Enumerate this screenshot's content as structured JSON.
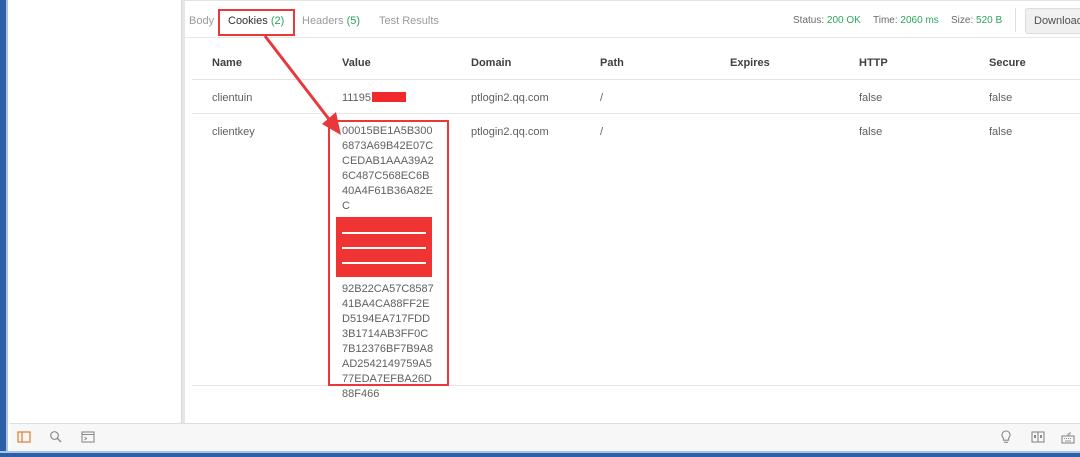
{
  "response_tabs": [
    {
      "label": "Body",
      "count": ""
    },
    {
      "label": "Cookies",
      "count": "(2)"
    },
    {
      "label": "Headers",
      "count": "(5)"
    },
    {
      "label": "Test Results",
      "count": ""
    }
  ],
  "active_tab": "Cookies",
  "status": {
    "label": "Status:",
    "value": "200 OK"
  },
  "time": {
    "label": "Time:",
    "value": "2060 ms"
  },
  "size": {
    "label": "Size:",
    "value": "520 B"
  },
  "download_label": "Download",
  "cookies": {
    "columns": [
      "Name",
      "Value",
      "Domain",
      "Path",
      "Expires",
      "HTTP",
      "Secure"
    ],
    "rows": [
      {
        "name": "clientuin",
        "value": "11195",
        "value_redacted": true,
        "domain": "ptlogin2.qq.com",
        "path": "/",
        "expires": "",
        "http": "false",
        "secure": "false"
      },
      {
        "name": "clientkey",
        "value_top": "00015BE1A5B3006873A69B42E07CCEDAB1AAA39A26C487C568EC6B40A4F61B36A82EC",
        "value_bottom": "92B22CA57C858741BA4CA88FF2ED5194EA717FDD3B1714AB3FF0C7B12376BF7B9A8AD2542149759A577EDA7EFBA26D88F466",
        "value_redacted": true,
        "domain": "ptlogin2.qq.com",
        "path": "/",
        "expires": "",
        "http": "false",
        "secure": "false"
      }
    ]
  },
  "annotation_color": "#e8383c",
  "status_color": "#2ba55d",
  "status_bar_icons": [
    "sidebar-toggle-icon",
    "search-icon",
    "console-icon",
    "lightbulb-icon",
    "two-pane-icon",
    "keyboard-icon"
  ]
}
